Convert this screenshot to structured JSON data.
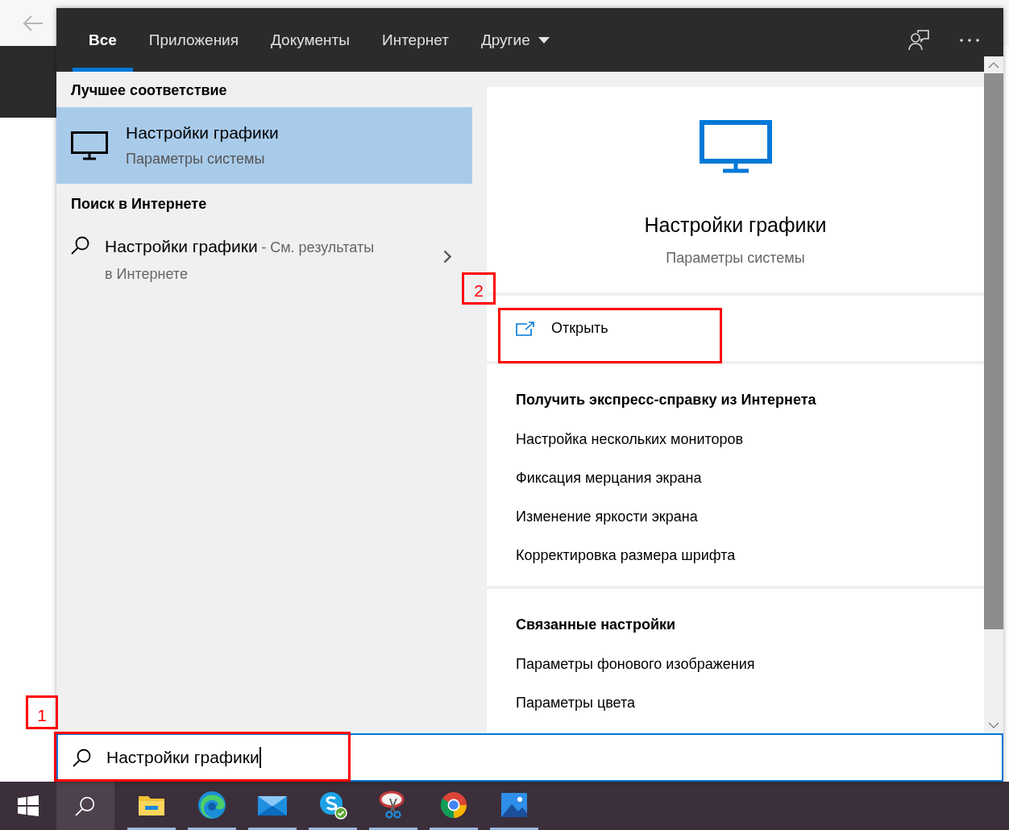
{
  "tabs": [
    {
      "label": "Все",
      "selected": true,
      "dropdown": false
    },
    {
      "label": "Приложения",
      "selected": false,
      "dropdown": false
    },
    {
      "label": "Документы",
      "selected": false,
      "dropdown": false
    },
    {
      "label": "Интернет",
      "selected": false,
      "dropdown": false
    },
    {
      "label": "Другие",
      "selected": false,
      "dropdown": true
    }
  ],
  "best_match": {
    "heading": "Лучшее соответствие",
    "items": [
      {
        "title": "Настройки графики",
        "subtitle": "Параметры системы",
        "selected": true
      }
    ]
  },
  "web_search": {
    "heading": "Поиск в Интернете",
    "items": [
      {
        "title": "Настройки графики",
        "hint": "- См. результаты в Интернете"
      }
    ]
  },
  "preview": {
    "title": "Настройки графики",
    "subtitle": "Параметры системы",
    "open_label": "Открыть"
  },
  "quick_help": {
    "heading": "Получить экспресс-справку из Интернета",
    "links": [
      "Настройка нескольких мониторов",
      "Фиксация мерцания экрана",
      "Изменение яркости экрана",
      "Корректировка размера шрифта"
    ]
  },
  "related": {
    "heading": "Связанные настройки",
    "links": [
      "Параметры фонового изображения",
      "Параметры цвета"
    ]
  },
  "search_box": {
    "value": "Настройки графики"
  },
  "taskbar": {
    "apps": [
      {
        "kind": "folder",
        "running": true
      },
      {
        "kind": "edge",
        "running": true
      },
      {
        "kind": "mail",
        "running": true
      },
      {
        "kind": "skype",
        "running": true
      },
      {
        "kind": "scissors",
        "running": true
      },
      {
        "kind": "chrome",
        "running": true
      },
      {
        "kind": "photos",
        "running": true
      }
    ]
  },
  "annotations": [
    {
      "label": "1",
      "kind": "search"
    },
    {
      "label": "2",
      "kind": "open"
    }
  ]
}
